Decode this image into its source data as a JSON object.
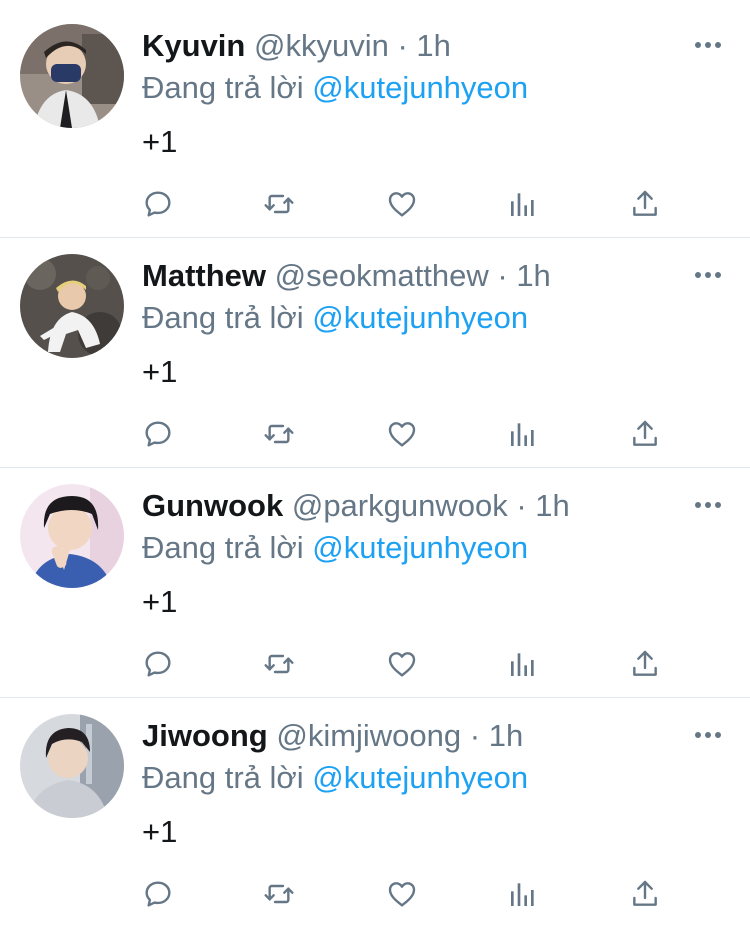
{
  "reply_prefix": "Đang trả lời",
  "dot": "·",
  "tweets": [
    {
      "name": "Kyuvin",
      "handle": "@kkyuvin",
      "time": "1h",
      "reply_to": "@kutejunhyeon",
      "text": "+1"
    },
    {
      "name": "Matthew",
      "handle": "@seokmatthew",
      "time": "1h",
      "reply_to": "@kutejunhyeon",
      "text": "+1"
    },
    {
      "name": "Gunwook",
      "handle": "@parkgunwook",
      "time": "1h",
      "reply_to": "@kutejunhyeon",
      "text": "+1"
    },
    {
      "name": "Jiwoong",
      "handle": "@kimjiwoong",
      "time": "1h",
      "reply_to": "@kutejunhyeon",
      "text": "+1"
    }
  ],
  "icons": {
    "reply": "reply-icon",
    "retweet": "retweet-icon",
    "like": "like-icon",
    "views": "views-icon",
    "share": "share-icon",
    "more": "more-icon"
  },
  "colors": {
    "name": "#14171a",
    "secondary": "#657786",
    "mention": "#1da1f2",
    "divider": "#e1e8ed"
  }
}
